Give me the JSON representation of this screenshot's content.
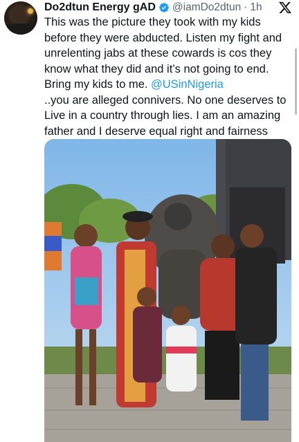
{
  "tweet": {
    "author_name": "Do2dtun Energy gAD",
    "handle": "@iamDo2dtun",
    "separator": "·",
    "time": "1h",
    "text_before_mention": "This was the picture they took with my kids before they were abducted. Listen my fight and unrelenting jabs at these cowards is cos they know what they did and it’s not going to end. Bring my kids to me. ",
    "mention": "@USinNigeria",
    "text_after_mention": "..you are alleged connivers. No one deserves to Live in a country through lies. I am an amazing father and I deserve equal right and fairness"
  },
  "icons": {
    "verified": "verified-badge-icon",
    "platform": "x-logo-icon"
  },
  "colors": {
    "accent": "#1d9bf0",
    "text": "#0f1419",
    "muted": "#536471"
  }
}
